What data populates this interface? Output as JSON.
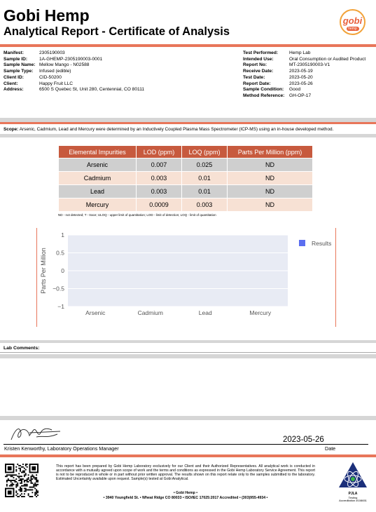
{
  "header": {
    "company": "Gobi Hemp",
    "report_title": "Analytical Report - Certificate of Analysis",
    "logo_text": "gobi",
    "logo_subtext": "hemp"
  },
  "info_left": [
    {
      "label": "Manifest:",
      "value": "2305190003"
    },
    {
      "label": "Sample ID:",
      "value": "1A-GHEMP-2305190003-0001"
    },
    {
      "label": "Sample Name:",
      "value": "Mellow Mango - N02588"
    },
    {
      "label": "Sample Type:",
      "value": "Infused (edible)"
    },
    {
      "label": "Client ID:",
      "value": "CID-50200"
    },
    {
      "label": "Client:",
      "value": "Happy Fruit LLC"
    },
    {
      "label": "Address:",
      "value": "6500 S Quebec St, Unit 280, Centennial, CO 80111"
    }
  ],
  "info_right": [
    {
      "label": "Test Performed:",
      "value": "Hemp Lab"
    },
    {
      "label": "Intended Use:",
      "value": "Oral Consumption or Audited Product"
    },
    {
      "label": "Report No:",
      "value": "MT-2305190003-V1"
    },
    {
      "label": "Receive Date:",
      "value": "2023-05-19"
    },
    {
      "label": "Test Date:",
      "value": "2023-05-20"
    },
    {
      "label": "Report Date:",
      "value": "2023-05-26"
    },
    {
      "label": "Sample Condition:",
      "value": "Good"
    },
    {
      "label": "Method Reference:",
      "value": "GH-OP-17"
    }
  ],
  "scope": {
    "label": "Scope:",
    "text": "Arsenic, Cadmium, Lead and Mercury were determined by an Inductively Coupled Plasma Mass Spectrometer (ICP-MS) using an in-house developed method."
  },
  "table": {
    "headers": [
      "Elemental Impurities",
      "LOD (ppm)",
      "LOQ (ppm)",
      "Parts Per Million (ppm)"
    ],
    "rows": [
      [
        "Arsenic",
        "0.007",
        "0.025",
        "ND"
      ],
      [
        "Cadmium",
        "0.003",
        "0.01",
        "ND"
      ],
      [
        "Lead",
        "0.003",
        "0.01",
        "ND"
      ],
      [
        "Mercury",
        "0.0009",
        "0.003",
        "ND"
      ]
    ],
    "note": "ND - not detected; T - trace; ULOQ - upper limit of quantitation; LOD - limit of detection; LOQ - limit of quantitation"
  },
  "chart_data": {
    "type": "bar",
    "categories": [
      "Arsenic",
      "Cadmium",
      "Lead",
      "Mercury"
    ],
    "series": [
      {
        "name": "Results",
        "values": [
          0,
          0,
          0,
          0
        ]
      }
    ],
    "ylabel": "Parts Per Million",
    "xlabel": "",
    "ylim": [
      -1,
      1
    ],
    "yticks": [
      "1",
      "0.5",
      "0",
      "−0.5",
      "−1"
    ],
    "legend_position": "top-right",
    "colors": {
      "series": "#5b6ef0",
      "plot_bg": "#e8ebf4"
    }
  },
  "lab_comments": {
    "label": "Lab Comments:",
    "text": ""
  },
  "signature": {
    "name": "Kristen Kenworthy, Laboratory Operations Manager",
    "date": "2023-05-26",
    "date_label": "Date"
  },
  "footer": {
    "disclaimer": "This report has been prepared by Gobi Hemp Laboratory exclusively for our Client and their Authorized Representatives. All analytical work is conducted in accordance with a mutually agreed upon scope of work and the terms and conditions as expressed in the Gobi Hemp Laboratory Service Agreement. This report is not to be reproduced in whole or in part without prior written approval. The results shown on this report relate only to the samples submitted to the laboratory. Estimated Uncertainty available upon request. Sample(s) tested at Gobi Analytical.",
    "addr_title": "• Gobi Hemp •",
    "addr_line": "• 3940 Youngfield St. • Wheat Ridge CO 80033 • ISO/IEC 17025:2017 Accredited • (303)955-4934 •",
    "pjla_name": "PJLA",
    "pjla_line1": "Testing",
    "pjla_line2": "Accreditation #108651"
  },
  "colors": {
    "accent": "#e8765a",
    "header_cell": "#c75a3e",
    "row_grey": "#cfcfcf",
    "row_peach": "#f7e1d4"
  }
}
